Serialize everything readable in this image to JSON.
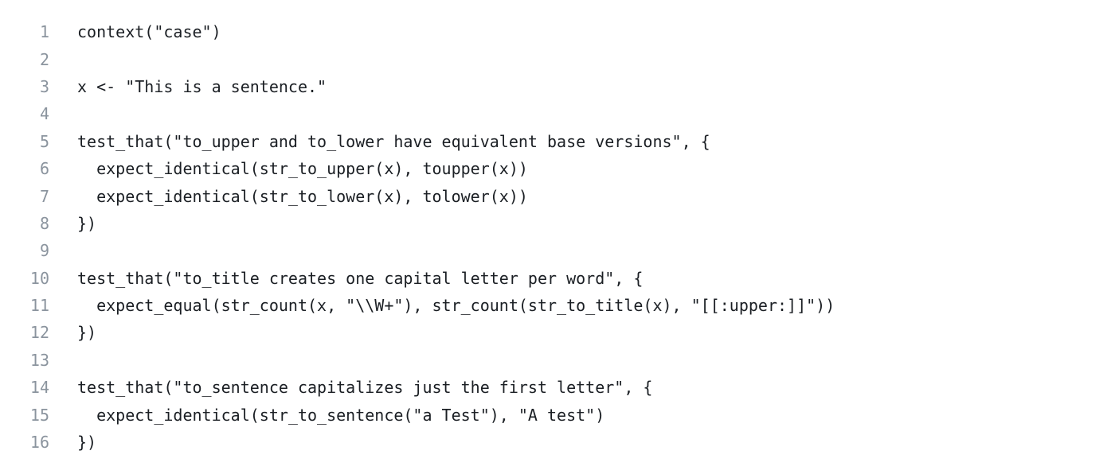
{
  "editor": {
    "lines": [
      {
        "number": "1",
        "text": "context(\"case\")"
      },
      {
        "number": "2",
        "text": ""
      },
      {
        "number": "3",
        "text": "x <- \"This is a sentence.\""
      },
      {
        "number": "4",
        "text": ""
      },
      {
        "number": "5",
        "text": "test_that(\"to_upper and to_lower have equivalent base versions\", {"
      },
      {
        "number": "6",
        "text": "  expect_identical(str_to_upper(x), toupper(x))"
      },
      {
        "number": "7",
        "text": "  expect_identical(str_to_lower(x), tolower(x))"
      },
      {
        "number": "8",
        "text": "})"
      },
      {
        "number": "9",
        "text": ""
      },
      {
        "number": "10",
        "text": "test_that(\"to_title creates one capital letter per word\", {"
      },
      {
        "number": "11",
        "text": "  expect_equal(str_count(x, \"\\\\W+\"), str_count(str_to_title(x), \"[[:upper:]]\"))"
      },
      {
        "number": "12",
        "text": "})"
      },
      {
        "number": "13",
        "text": ""
      },
      {
        "number": "14",
        "text": "test_that(\"to_sentence capitalizes just the first letter\", {"
      },
      {
        "number": "15",
        "text": "  expect_identical(str_to_sentence(\"a Test\"), \"A test\")"
      },
      {
        "number": "16",
        "text": "})"
      }
    ]
  }
}
